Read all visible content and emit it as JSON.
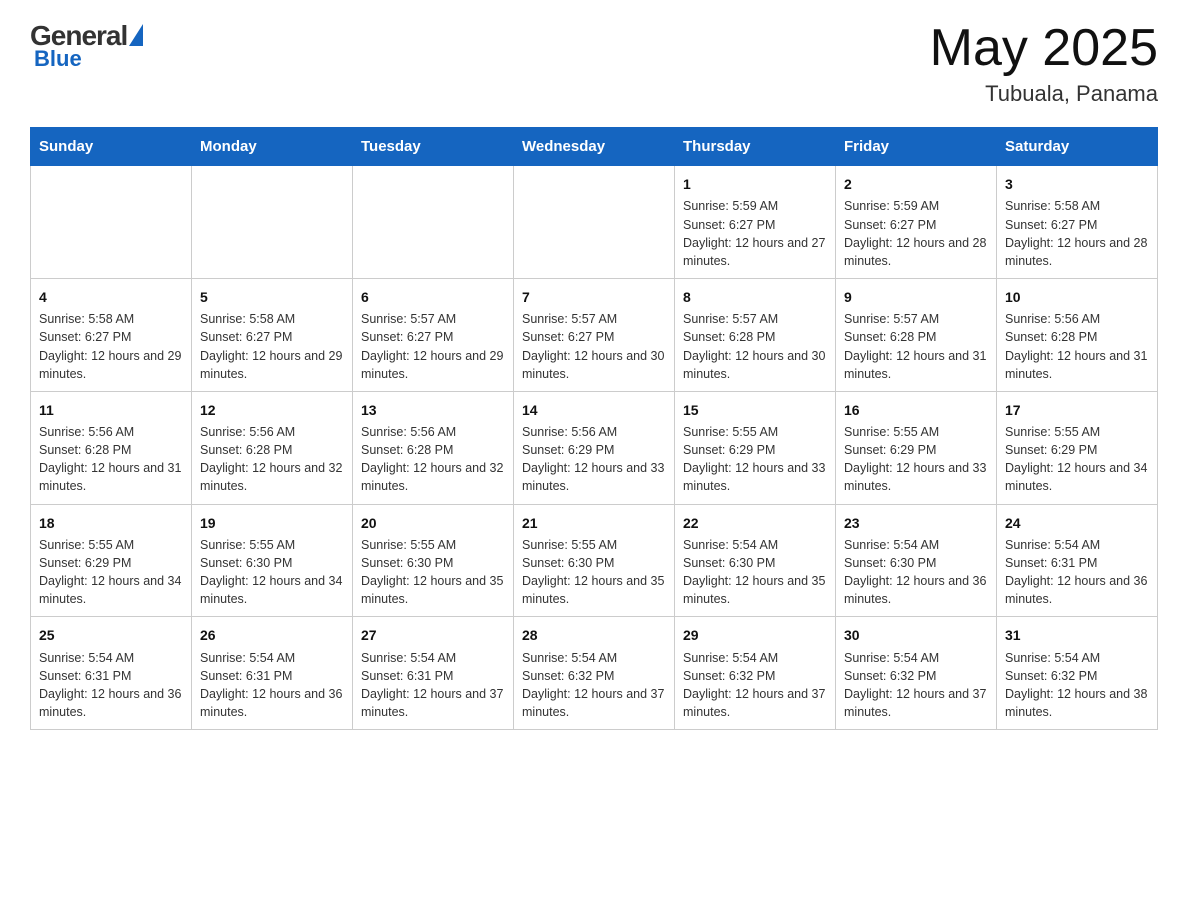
{
  "header": {
    "logo_general": "General",
    "logo_blue": "Blue",
    "month_year": "May 2025",
    "location": "Tubuala, Panama"
  },
  "days_of_week": [
    "Sunday",
    "Monday",
    "Tuesday",
    "Wednesday",
    "Thursday",
    "Friday",
    "Saturday"
  ],
  "weeks": [
    [
      {
        "day": "",
        "info": ""
      },
      {
        "day": "",
        "info": ""
      },
      {
        "day": "",
        "info": ""
      },
      {
        "day": "",
        "info": ""
      },
      {
        "day": "1",
        "info": "Sunrise: 5:59 AM\nSunset: 6:27 PM\nDaylight: 12 hours and 27 minutes."
      },
      {
        "day": "2",
        "info": "Sunrise: 5:59 AM\nSunset: 6:27 PM\nDaylight: 12 hours and 28 minutes."
      },
      {
        "day": "3",
        "info": "Sunrise: 5:58 AM\nSunset: 6:27 PM\nDaylight: 12 hours and 28 minutes."
      }
    ],
    [
      {
        "day": "4",
        "info": "Sunrise: 5:58 AM\nSunset: 6:27 PM\nDaylight: 12 hours and 29 minutes."
      },
      {
        "day": "5",
        "info": "Sunrise: 5:58 AM\nSunset: 6:27 PM\nDaylight: 12 hours and 29 minutes."
      },
      {
        "day": "6",
        "info": "Sunrise: 5:57 AM\nSunset: 6:27 PM\nDaylight: 12 hours and 29 minutes."
      },
      {
        "day": "7",
        "info": "Sunrise: 5:57 AM\nSunset: 6:27 PM\nDaylight: 12 hours and 30 minutes."
      },
      {
        "day": "8",
        "info": "Sunrise: 5:57 AM\nSunset: 6:28 PM\nDaylight: 12 hours and 30 minutes."
      },
      {
        "day": "9",
        "info": "Sunrise: 5:57 AM\nSunset: 6:28 PM\nDaylight: 12 hours and 31 minutes."
      },
      {
        "day": "10",
        "info": "Sunrise: 5:56 AM\nSunset: 6:28 PM\nDaylight: 12 hours and 31 minutes."
      }
    ],
    [
      {
        "day": "11",
        "info": "Sunrise: 5:56 AM\nSunset: 6:28 PM\nDaylight: 12 hours and 31 minutes."
      },
      {
        "day": "12",
        "info": "Sunrise: 5:56 AM\nSunset: 6:28 PM\nDaylight: 12 hours and 32 minutes."
      },
      {
        "day": "13",
        "info": "Sunrise: 5:56 AM\nSunset: 6:28 PM\nDaylight: 12 hours and 32 minutes."
      },
      {
        "day": "14",
        "info": "Sunrise: 5:56 AM\nSunset: 6:29 PM\nDaylight: 12 hours and 33 minutes."
      },
      {
        "day": "15",
        "info": "Sunrise: 5:55 AM\nSunset: 6:29 PM\nDaylight: 12 hours and 33 minutes."
      },
      {
        "day": "16",
        "info": "Sunrise: 5:55 AM\nSunset: 6:29 PM\nDaylight: 12 hours and 33 minutes."
      },
      {
        "day": "17",
        "info": "Sunrise: 5:55 AM\nSunset: 6:29 PM\nDaylight: 12 hours and 34 minutes."
      }
    ],
    [
      {
        "day": "18",
        "info": "Sunrise: 5:55 AM\nSunset: 6:29 PM\nDaylight: 12 hours and 34 minutes."
      },
      {
        "day": "19",
        "info": "Sunrise: 5:55 AM\nSunset: 6:30 PM\nDaylight: 12 hours and 34 minutes."
      },
      {
        "day": "20",
        "info": "Sunrise: 5:55 AM\nSunset: 6:30 PM\nDaylight: 12 hours and 35 minutes."
      },
      {
        "day": "21",
        "info": "Sunrise: 5:55 AM\nSunset: 6:30 PM\nDaylight: 12 hours and 35 minutes."
      },
      {
        "day": "22",
        "info": "Sunrise: 5:54 AM\nSunset: 6:30 PM\nDaylight: 12 hours and 35 minutes."
      },
      {
        "day": "23",
        "info": "Sunrise: 5:54 AM\nSunset: 6:30 PM\nDaylight: 12 hours and 36 minutes."
      },
      {
        "day": "24",
        "info": "Sunrise: 5:54 AM\nSunset: 6:31 PM\nDaylight: 12 hours and 36 minutes."
      }
    ],
    [
      {
        "day": "25",
        "info": "Sunrise: 5:54 AM\nSunset: 6:31 PM\nDaylight: 12 hours and 36 minutes."
      },
      {
        "day": "26",
        "info": "Sunrise: 5:54 AM\nSunset: 6:31 PM\nDaylight: 12 hours and 36 minutes."
      },
      {
        "day": "27",
        "info": "Sunrise: 5:54 AM\nSunset: 6:31 PM\nDaylight: 12 hours and 37 minutes."
      },
      {
        "day": "28",
        "info": "Sunrise: 5:54 AM\nSunset: 6:32 PM\nDaylight: 12 hours and 37 minutes."
      },
      {
        "day": "29",
        "info": "Sunrise: 5:54 AM\nSunset: 6:32 PM\nDaylight: 12 hours and 37 minutes."
      },
      {
        "day": "30",
        "info": "Sunrise: 5:54 AM\nSunset: 6:32 PM\nDaylight: 12 hours and 37 minutes."
      },
      {
        "day": "31",
        "info": "Sunrise: 5:54 AM\nSunset: 6:32 PM\nDaylight: 12 hours and 38 minutes."
      }
    ]
  ]
}
